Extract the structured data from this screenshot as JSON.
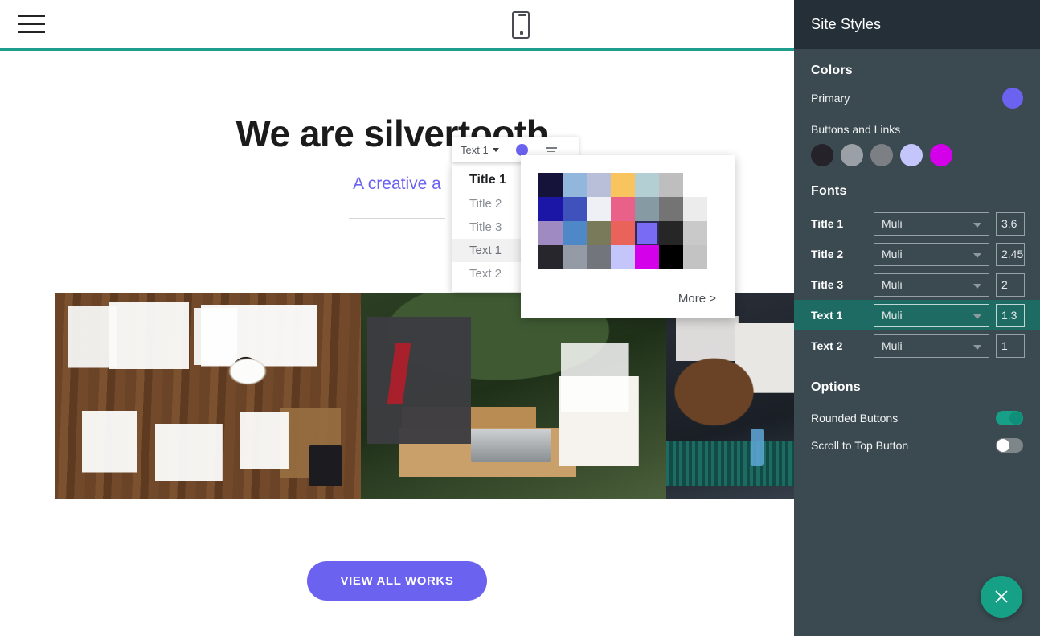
{
  "site_header": {
    "menu_icon": "hamburger-menu-icon",
    "device_icon": "mobile-preview-icon",
    "accent_rule_color": "#1f9e8e"
  },
  "hero": {
    "title": "We are silvertooth.",
    "subtitle": "A creative a",
    "cta_label": "VIEW ALL WORKS",
    "cta_color": "#6b62f0",
    "subtitle_color": "#6b62f0"
  },
  "gallery": {
    "items": [
      {
        "name": "desk-flatlay-photo",
        "alt": "Wooden desk with documents, laptop, calculator and coffee"
      },
      {
        "name": "outdoor-meeting-photo",
        "alt": "Man typing on laptop and woman reading a business newspaper outdoors"
      },
      {
        "name": "audience-photo",
        "alt": "Person seen from behind in an audience at a presentation"
      }
    ]
  },
  "inline_toolbar": {
    "style_label": "Text 1",
    "caret_icon": "chevron-down-icon",
    "color_dot": "#6b62f0",
    "color_dot_icon": "text-color-icon",
    "align_icon": "text-align-icon"
  },
  "style_menu": {
    "items": [
      {
        "label": "Title 1",
        "state": "heading"
      },
      {
        "label": "Title 2",
        "state": "normal"
      },
      {
        "label": "Title 3",
        "state": "normal"
      },
      {
        "label": "Text 1",
        "state": "active"
      },
      {
        "label": "Text 2",
        "state": "normal"
      }
    ]
  },
  "color_popover": {
    "more_label": "More >",
    "selected_index": 18,
    "swatches": [
      "#16133a",
      "#92b7dc",
      "#b9bfd8",
      "#f9c45e",
      "#b3cfd4",
      "#bebebe",
      "#ffffff",
      "#1c16a6",
      "#3f52bb",
      "#eff0f5",
      "#e96089",
      "#869aa3",
      "#747474",
      "#ececec",
      "#9f8bc2",
      "#4f88c7",
      "#787a5a",
      "#e9635b",
      "#7a6bf5",
      "#262626",
      "#c9c9c9",
      "#26262c",
      "#949ba7",
      "#73757c",
      "#c3c5fb",
      "#d400ea",
      "#000000",
      "#c3c3c3"
    ]
  },
  "panel": {
    "title": "Site Styles",
    "colors": {
      "section_label": "Colors",
      "primary_label": "Primary",
      "primary_color": "#6b62f0",
      "buttons_links_label": "Buttons and Links",
      "buttons_links_colors": [
        "#252229",
        "#9aa0a6",
        "#7c8085",
        "#c3c5fb",
        "#d400ea"
      ]
    },
    "fonts": {
      "section_label": "Fonts",
      "rows": [
        {
          "label": "Title 1",
          "font": "Muli",
          "size": "3.6",
          "active": false
        },
        {
          "label": "Title 2",
          "font": "Muli",
          "size": "2.45",
          "active": false
        },
        {
          "label": "Title 3",
          "font": "Muli",
          "size": "2",
          "active": false
        },
        {
          "label": "Text 1",
          "font": "Muli",
          "size": "1.3",
          "active": true
        },
        {
          "label": "Text 2",
          "font": "Muli",
          "size": "1",
          "active": false
        }
      ]
    },
    "options": {
      "section_label": "Options",
      "rounded_buttons": {
        "label": "Rounded Buttons",
        "value": "on"
      },
      "scroll_to_top": {
        "label": "Scroll to Top Button",
        "value": "off"
      }
    },
    "close_button": {
      "icon": "close-icon",
      "color": "#16a085"
    },
    "accent_color": "#1d6b62",
    "header_bg": "#242f38",
    "body_bg": "#3b4a51"
  }
}
